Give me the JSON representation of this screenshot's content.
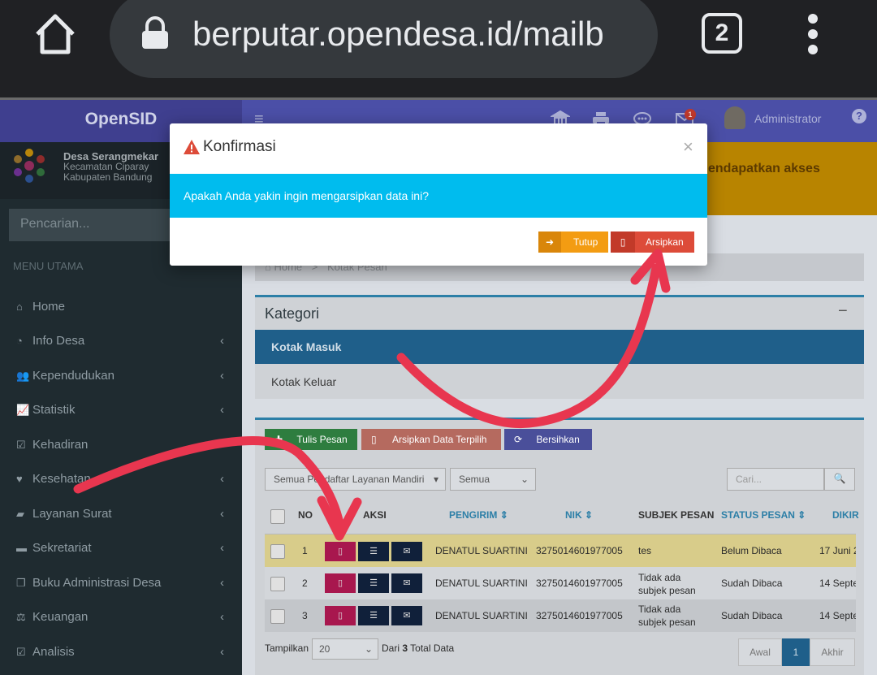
{
  "browser": {
    "url": "berputar.opendesa.id/mailb",
    "tab_count": "2"
  },
  "app": {
    "brand": "OpenSID",
    "user": "Administrator",
    "mail_badge": "1"
  },
  "village": {
    "name": "Desa Serangmekar",
    "district": "Kecamatan Ciparay",
    "regency": "Kabupaten Bandung"
  },
  "sidebar": {
    "search_placeholder": "Pencarian...",
    "menu_header": "MENU UTAMA",
    "items": [
      {
        "label": "Home"
      },
      {
        "label": "Info Desa"
      },
      {
        "label": "Kependudukan"
      },
      {
        "label": "Statistik"
      },
      {
        "label": "Kehadiran"
      },
      {
        "label": "Kesehatan"
      },
      {
        "label": "Layanan Surat"
      },
      {
        "label": "Sekretariat"
      },
      {
        "label": "Buku Administrasi Desa"
      },
      {
        "label": "Keuangan"
      },
      {
        "label": "Analisis"
      }
    ]
  },
  "alert_banner": "endapatkan akses",
  "breadcrumb": {
    "home": "Home",
    "sep": ">",
    "current": "Kotak Pesan"
  },
  "kategori": {
    "title": "Kategori",
    "collapse": "−",
    "inbox": "Kotak Masuk",
    "outbox": "Kotak Keluar"
  },
  "toolbar": {
    "compose": "Tulis Pesan",
    "archive_selected": "Arsipkan Data Terpilih",
    "clear": "Bersihkan"
  },
  "filters": {
    "type": "Semua Pendaftar Layanan Mandiri",
    "status": "Semua",
    "search_placeholder": "Cari..."
  },
  "table": {
    "headers": {
      "no": "NO",
      "aksi": "AKSI",
      "pengirim": "PENGIRIM",
      "nik": "NIK",
      "subjek": "SUBJEK PESAN",
      "status": "STATUS PESAN",
      "dikirim": "DIKIR"
    },
    "rows": [
      {
        "no": "1",
        "sender": "DENATUL SUARTINI",
        "nik": "3275014601977005",
        "subject": "tes",
        "status": "Belum Dibaca",
        "date": "17 Juni 2"
      },
      {
        "no": "2",
        "sender": "DENATUL SUARTINI",
        "nik": "3275014601977005",
        "subject": "Tidak ada subjek pesan",
        "status": "Sudah Dibaca",
        "date": "14 Septe"
      },
      {
        "no": "3",
        "sender": "DENATUL SUARTINI",
        "nik": "3275014601977005",
        "subject": "Tidak ada subjek pesan",
        "status": "Sudah Dibaca",
        "date": "14 Septe"
      }
    ]
  },
  "footer": {
    "show_label": "Tampilkan",
    "per_page": "20",
    "total_prefix": "Dari",
    "total": "3",
    "total_suffix": "Total Data",
    "first": "Awal",
    "page": "1",
    "last": "Akhir"
  },
  "modal": {
    "title": "Konfirmasi",
    "close": "×",
    "message": "Apakah Anda yakin ingin mengarsipkan data ini?",
    "cancel": "Tutup",
    "confirm": "Arsipkan"
  },
  "colors": {
    "modal_body": "#00bcee",
    "cancel_btn": "#f39c12",
    "confirm_btn": "#dd4b39",
    "annotation_arrow": "#e8364f"
  }
}
